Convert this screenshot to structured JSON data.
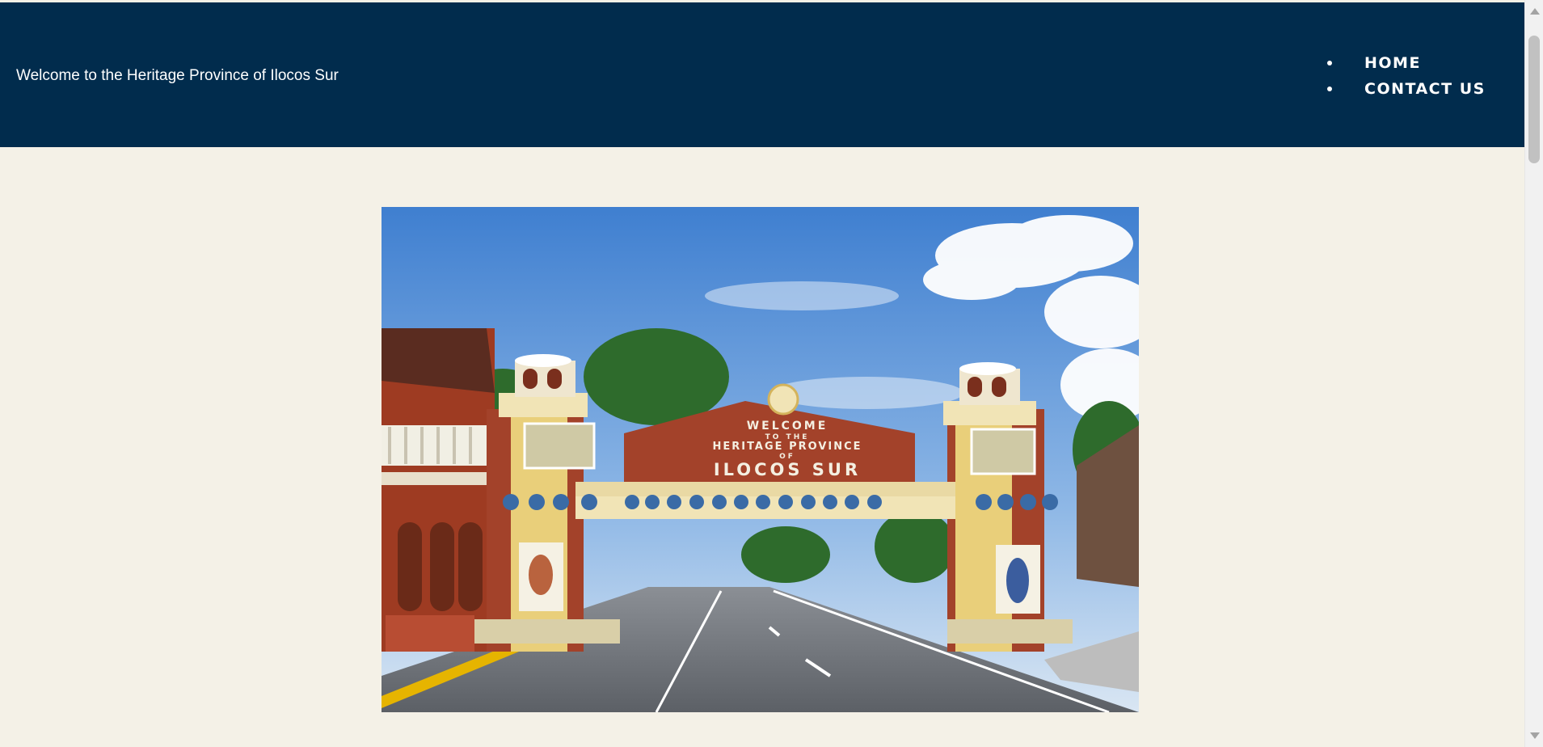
{
  "header": {
    "title": "Welcome to the Heritage Province of Ilocos Sur",
    "background_color": "#012c4d"
  },
  "nav": {
    "items": [
      {
        "label": "HOME"
      },
      {
        "label": "CONTACT US"
      }
    ]
  },
  "hero": {
    "arch_text": {
      "line1": "WELCOME",
      "line2": "TO THE",
      "line3": "HERITAGE PROVINCE",
      "line4": "OF",
      "line5": "ILOCOS SUR"
    }
  },
  "colors": {
    "page_background": "#f4f1e7",
    "header_text": "#ffffff"
  }
}
